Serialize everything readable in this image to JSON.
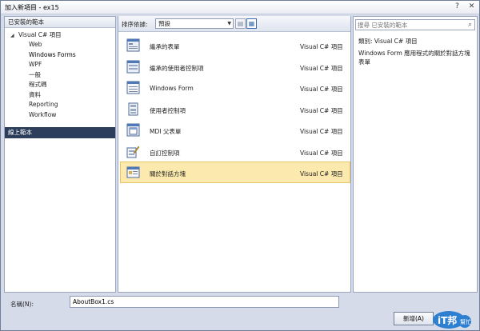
{
  "window": {
    "title": "加入新項目 - ex15"
  },
  "titlebar": {
    "help": "?",
    "close": "✕"
  },
  "left": {
    "header": "已安裝的範本",
    "root": "Visual C# 項目",
    "items": [
      "Web",
      "Windows Forms",
      "WPF",
      "一般",
      "程式碼",
      "資料",
      "Reporting",
      "Workflow"
    ],
    "online": "線上範本"
  },
  "toolbar": {
    "sort_label": "排序依據:",
    "sort_value": "預設"
  },
  "templates": [
    {
      "name": "繼承的表單",
      "lang": "Visual C# 項目",
      "icon": "inherited-form-icon"
    },
    {
      "name": "繼承的使用者控制項",
      "lang": "Visual C# 項目",
      "icon": "inherited-user-control-icon"
    },
    {
      "name": "Windows Form",
      "lang": "Visual C# 項目",
      "icon": "windows-form-icon"
    },
    {
      "name": "使用者控制項",
      "lang": "Visual C# 項目",
      "icon": "user-control-icon"
    },
    {
      "name": "MDI 父表單",
      "lang": "Visual C# 項目",
      "icon": "mdi-parent-form-icon"
    },
    {
      "name": "自訂控制項",
      "lang": "Visual C# 項目",
      "icon": "custom-control-icon"
    },
    {
      "name": "關於對話方塊",
      "lang": "Visual C# 項目",
      "icon": "about-box-icon"
    }
  ],
  "right": {
    "search_placeholder": "搜尋 已安裝的範本",
    "type_line": "類別: Visual C# 項目",
    "description": "Windows Form 應用程式的關於對話方塊表單"
  },
  "bottom": {
    "name_label": "名稱(N):",
    "name_value": "AboutBox1.cs",
    "add_button": "新增(A)"
  },
  "logo": {
    "text": "iT邦",
    "sub": "幫忙"
  }
}
